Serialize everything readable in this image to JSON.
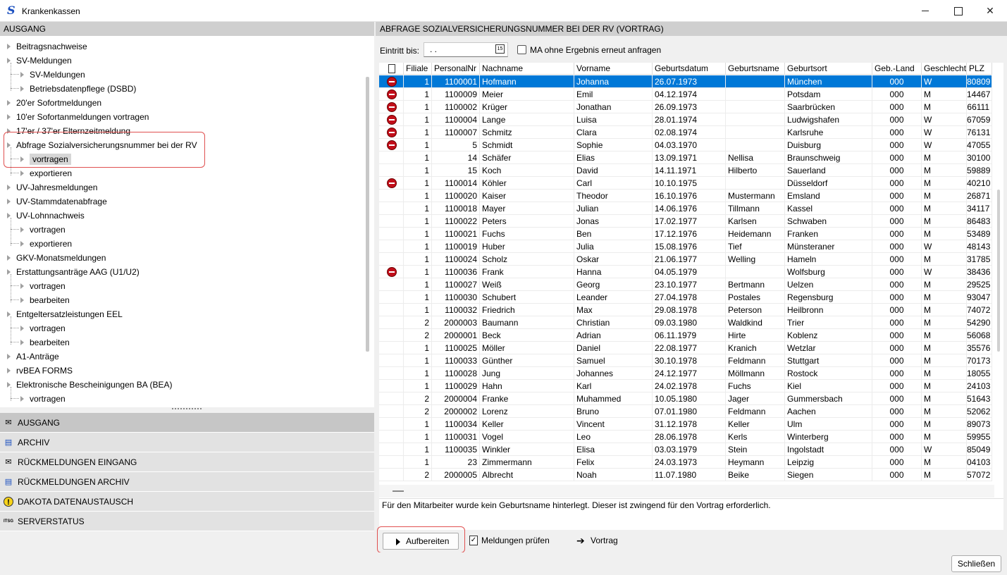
{
  "window": {
    "title": "Krankenkassen",
    "close_button": "Schließen"
  },
  "left": {
    "header": "AUSGANG",
    "tree": [
      {
        "label": "Beitragsnachweise",
        "level": 0
      },
      {
        "label": "SV-Meldungen",
        "level": 0
      },
      {
        "label": "SV-Meldungen",
        "level": 1
      },
      {
        "label": "Betriebsdatenpflege (DSBD)",
        "level": 1
      },
      {
        "label": "20'er Sofortmeldungen",
        "level": 0
      },
      {
        "label": "10'er Sofortanmeldungen vortragen",
        "level": 0
      },
      {
        "label": "17'er / 37'er Elternzeitmeldung",
        "level": 0
      },
      {
        "label": "Abfrage Sozialversicherungsnummer bei der RV",
        "level": 0
      },
      {
        "label": "vortragen",
        "level": 1,
        "selected": true
      },
      {
        "label": "exportieren",
        "level": 1
      },
      {
        "label": "UV-Jahresmeldungen",
        "level": 0
      },
      {
        "label": "UV-Stammdatenabfrage",
        "level": 0
      },
      {
        "label": "UV-Lohnnachweis",
        "level": 0
      },
      {
        "label": "vortragen",
        "level": 1
      },
      {
        "label": "exportieren",
        "level": 1
      },
      {
        "label": "GKV-Monatsmeldungen",
        "level": 0
      },
      {
        "label": "Erstattungsanträge AAG (U1/U2)",
        "level": 0
      },
      {
        "label": "vortragen",
        "level": 1
      },
      {
        "label": "bearbeiten",
        "level": 1
      },
      {
        "label": "Entgeltersatzleistungen EEL",
        "level": 0
      },
      {
        "label": "vortragen",
        "level": 1
      },
      {
        "label": "bearbeiten",
        "level": 1
      },
      {
        "label": "A1-Anträge",
        "level": 0
      },
      {
        "label": "rvBEA FORMS",
        "level": 0
      },
      {
        "label": "Elektronische Bescheinigungen BA (BEA)",
        "level": 0
      },
      {
        "label": "vortragen",
        "level": 1
      }
    ],
    "nav": [
      {
        "label": "AUSGANG",
        "icon": "envelope-out-icon",
        "glyph": "✉",
        "active": true
      },
      {
        "label": "ARCHIV",
        "icon": "archive-icon",
        "glyph": "▤",
        "active": false
      },
      {
        "label": "RÜCKMELDUNGEN EINGANG",
        "icon": "envelope-in-icon",
        "glyph": "✉",
        "active": false
      },
      {
        "label": "RÜCKMELDUNGEN ARCHIV",
        "icon": "archive-download-icon",
        "glyph": "▤",
        "active": false
      },
      {
        "label": "DAKOTA DATENAUSTAUSCH",
        "icon": "warning-icon",
        "glyph": "!",
        "active": false
      },
      {
        "label": "SERVERSTATUS",
        "icon": "server-status-icon",
        "glyph": "ITSG",
        "active": false
      }
    ]
  },
  "right": {
    "header": "ABFRAGE SOZIALVERSICHERUNGSNUMMER BEI DER RV (VORTRAG)",
    "filter": {
      "eintritt_label": "Eintritt bis:",
      "eintritt_value": ". .",
      "checkbox_label": "MA ohne Ergebnis erneut anfragen"
    },
    "columns": [
      "",
      "Filiale",
      "PersonalNr",
      "Nachname",
      "Vorname",
      "Geburtsdatum",
      "Geburtsname",
      "Geburtsort",
      "Geb.-Land",
      "Geschlecht",
      "PLZ"
    ],
    "rows": [
      {
        "err": true,
        "filiale": "1",
        "nr": "1100001",
        "nachname": "Hofmann",
        "vorname": "Johanna",
        "gebdat": "26.07.1973",
        "gebname": "",
        "gebort": "München",
        "land": "000",
        "geschl": "W",
        "plz": "80809",
        "selected": true
      },
      {
        "err": true,
        "filiale": "1",
        "nr": "1100009",
        "nachname": "Meier",
        "vorname": "Emil",
        "gebdat": "04.12.1974",
        "gebname": "",
        "gebort": "Potsdam",
        "land": "000",
        "geschl": "M",
        "plz": "14467"
      },
      {
        "err": true,
        "filiale": "1",
        "nr": "1100002",
        "nachname": "Krüger",
        "vorname": "Jonathan",
        "gebdat": "26.09.1973",
        "gebname": "",
        "gebort": "Saarbrücken",
        "land": "000",
        "geschl": "M",
        "plz": "66111"
      },
      {
        "err": true,
        "filiale": "1",
        "nr": "1100004",
        "nachname": "Lange",
        "vorname": "Luisa",
        "gebdat": "28.01.1974",
        "gebname": "",
        "gebort": "Ludwigshafen",
        "land": "000",
        "geschl": "W",
        "plz": "67059"
      },
      {
        "err": true,
        "filiale": "1",
        "nr": "1100007",
        "nachname": "Schmitz",
        "vorname": "Clara",
        "gebdat": "02.08.1974",
        "gebname": "",
        "gebort": "Karlsruhe",
        "land": "000",
        "geschl": "W",
        "plz": "76131"
      },
      {
        "err": true,
        "filiale": "1",
        "nr": "5",
        "nachname": "Schmidt",
        "vorname": "Sophie",
        "gebdat": "04.03.1970",
        "gebname": "",
        "gebort": "Duisburg",
        "land": "000",
        "geschl": "W",
        "plz": "47055"
      },
      {
        "err": false,
        "filiale": "1",
        "nr": "14",
        "nachname": "Schäfer",
        "vorname": "Elias",
        "gebdat": "13.09.1971",
        "gebname": "Nellisa",
        "gebort": "Braunschweig",
        "land": "000",
        "geschl": "M",
        "plz": "30100"
      },
      {
        "err": false,
        "filiale": "1",
        "nr": "15",
        "nachname": "Koch",
        "vorname": "David",
        "gebdat": "14.11.1971",
        "gebname": "Hilberto",
        "gebort": "Sauerland",
        "land": "000",
        "geschl": "M",
        "plz": "59889"
      },
      {
        "err": true,
        "filiale": "1",
        "nr": "1100014",
        "nachname": "Köhler",
        "vorname": "Carl",
        "gebdat": "10.10.1975",
        "gebname": "",
        "gebort": "Düsseldorf",
        "land": "000",
        "geschl": "M",
        "plz": "40210"
      },
      {
        "err": false,
        "filiale": "1",
        "nr": "1100020",
        "nachname": "Kaiser",
        "vorname": "Theodor",
        "gebdat": "16.10.1976",
        "gebname": "Mustermann",
        "gebort": "Emsland",
        "land": "000",
        "geschl": "M",
        "plz": "26871"
      },
      {
        "err": false,
        "filiale": "1",
        "nr": "1100018",
        "nachname": "Mayer",
        "vorname": "Julian",
        "gebdat": "14.06.1976",
        "gebname": "Tillmann",
        "gebort": "Kassel",
        "land": "000",
        "geschl": "M",
        "plz": "34117"
      },
      {
        "err": false,
        "filiale": "1",
        "nr": "1100022",
        "nachname": "Peters",
        "vorname": "Jonas",
        "gebdat": "17.02.1977",
        "gebname": "Karlsen",
        "gebort": "Schwaben",
        "land": "000",
        "geschl": "M",
        "plz": "86483"
      },
      {
        "err": false,
        "filiale": "1",
        "nr": "1100021",
        "nachname": "Fuchs",
        "vorname": "Ben",
        "gebdat": "17.12.1976",
        "gebname": "Heidemann",
        "gebort": "Franken",
        "land": "000",
        "geschl": "M",
        "plz": "53489"
      },
      {
        "err": false,
        "filiale": "1",
        "nr": "1100019",
        "nachname": "Huber",
        "vorname": "Julia",
        "gebdat": "15.08.1976",
        "gebname": "Tief",
        "gebort": "Münsteraner",
        "land": "000",
        "geschl": "W",
        "plz": "48143"
      },
      {
        "err": false,
        "filiale": "1",
        "nr": "1100024",
        "nachname": "Scholz",
        "vorname": "Oskar",
        "gebdat": "21.06.1977",
        "gebname": "Welling",
        "gebort": "Hameln",
        "land": "000",
        "geschl": "M",
        "plz": "31785"
      },
      {
        "err": true,
        "filiale": "1",
        "nr": "1100036",
        "nachname": "Frank",
        "vorname": "Hanna",
        "gebdat": "04.05.1979",
        "gebname": "",
        "gebort": "Wolfsburg",
        "land": "000",
        "geschl": "W",
        "plz": "38436"
      },
      {
        "err": false,
        "filiale": "1",
        "nr": "1100027",
        "nachname": "Weiß",
        "vorname": "Georg",
        "gebdat": "23.10.1977",
        "gebname": "Bertmann",
        "gebort": "Uelzen",
        "land": "000",
        "geschl": "M",
        "plz": "29525"
      },
      {
        "err": false,
        "filiale": "1",
        "nr": "1100030",
        "nachname": "Schubert",
        "vorname": "Leander",
        "gebdat": "27.04.1978",
        "gebname": "Postales",
        "gebort": "Regensburg",
        "land": "000",
        "geschl": "M",
        "plz": "93047"
      },
      {
        "err": false,
        "filiale": "1",
        "nr": "1100032",
        "nachname": "Friedrich",
        "vorname": "Max",
        "gebdat": "29.08.1978",
        "gebname": "Peterson",
        "gebort": "Heilbronn",
        "land": "000",
        "geschl": "M",
        "plz": "74072"
      },
      {
        "err": false,
        "filiale": "2",
        "nr": "2000003",
        "nachname": "Baumann",
        "vorname": "Christian",
        "gebdat": "09.03.1980",
        "gebname": "Waldkind",
        "gebort": "Trier",
        "land": "000",
        "geschl": "M",
        "plz": "54290"
      },
      {
        "err": false,
        "filiale": "2",
        "nr": "2000001",
        "nachname": "Beck",
        "vorname": "Adrian",
        "gebdat": "06.11.1979",
        "gebname": "Hirte",
        "gebort": "Koblenz",
        "land": "000",
        "geschl": "M",
        "plz": "56068"
      },
      {
        "err": false,
        "filiale": "1",
        "nr": "1100025",
        "nachname": "Möller",
        "vorname": "Daniel",
        "gebdat": "22.08.1977",
        "gebname": "Kranich",
        "gebort": "Wetzlar",
        "land": "000",
        "geschl": "M",
        "plz": "35576"
      },
      {
        "err": false,
        "filiale": "1",
        "nr": "1100033",
        "nachname": "Günther",
        "vorname": "Samuel",
        "gebdat": "30.10.1978",
        "gebname": "Feldmann",
        "gebort": "Stuttgart",
        "land": "000",
        "geschl": "M",
        "plz": "70173"
      },
      {
        "err": false,
        "filiale": "1",
        "nr": "1100028",
        "nachname": "Jung",
        "vorname": "Johannes",
        "gebdat": "24.12.1977",
        "gebname": "Möllmann",
        "gebort": "Rostock",
        "land": "000",
        "geschl": "M",
        "plz": "18055"
      },
      {
        "err": false,
        "filiale": "1",
        "nr": "1100029",
        "nachname": "Hahn",
        "vorname": "Karl",
        "gebdat": "24.02.1978",
        "gebname": "Fuchs",
        "gebort": "Kiel",
        "land": "000",
        "geschl": "M",
        "plz": "24103"
      },
      {
        "err": false,
        "filiale": "2",
        "nr": "2000004",
        "nachname": "Franke",
        "vorname": "Muhammed",
        "gebdat": "10.05.1980",
        "gebname": "Jager",
        "gebort": "Gummersbach",
        "land": "000",
        "geschl": "M",
        "plz": "51643"
      },
      {
        "err": false,
        "filiale": "2",
        "nr": "2000002",
        "nachname": "Lorenz",
        "vorname": "Bruno",
        "gebdat": "07.01.1980",
        "gebname": "Feldmann",
        "gebort": "Aachen",
        "land": "000",
        "geschl": "M",
        "plz": "52062"
      },
      {
        "err": false,
        "filiale": "1",
        "nr": "1100034",
        "nachname": "Keller",
        "vorname": "Vincent",
        "gebdat": "31.12.1978",
        "gebname": "Keller",
        "gebort": "Ulm",
        "land": "000",
        "geschl": "M",
        "plz": "89073"
      },
      {
        "err": false,
        "filiale": "1",
        "nr": "1100031",
        "nachname": "Vogel",
        "vorname": "Leo",
        "gebdat": "28.06.1978",
        "gebname": "Kerls",
        "gebort": "Winterberg",
        "land": "000",
        "geschl": "M",
        "plz": "59955"
      },
      {
        "err": false,
        "filiale": "1",
        "nr": "1100035",
        "nachname": "Winkler",
        "vorname": "Elisa",
        "gebdat": "03.03.1979",
        "gebname": "Stein",
        "gebort": "Ingolstadt",
        "land": "000",
        "geschl": "W",
        "plz": "85049"
      },
      {
        "err": false,
        "filiale": "1",
        "nr": "23",
        "nachname": "Zimmermann",
        "vorname": "Felix",
        "gebdat": "24.03.1973",
        "gebname": "Heymann",
        "gebort": "Leipzig",
        "land": "000",
        "geschl": "M",
        "plz": "04103"
      },
      {
        "err": false,
        "filiale": "2",
        "nr": "2000005",
        "nachname": "Albrecht",
        "vorname": "Noah",
        "gebdat": "11.07.1980",
        "gebname": "Beike",
        "gebort": "Siegen",
        "land": "000",
        "geschl": "M",
        "plz": "57072"
      }
    ],
    "message": "Für den Mitarbeiter wurde kein Geburtsname hinterlegt. Dieser ist zwingend für den Vortrag erforderlich.",
    "actions": {
      "aufbereiten": "Aufbereiten",
      "pruefen": "Meldungen prüfen",
      "vortrag": "Vortrag"
    }
  },
  "colors": {
    "selection": "#0078d7",
    "error_icon": "#c20e1a",
    "highlight_box": "#e05050"
  }
}
